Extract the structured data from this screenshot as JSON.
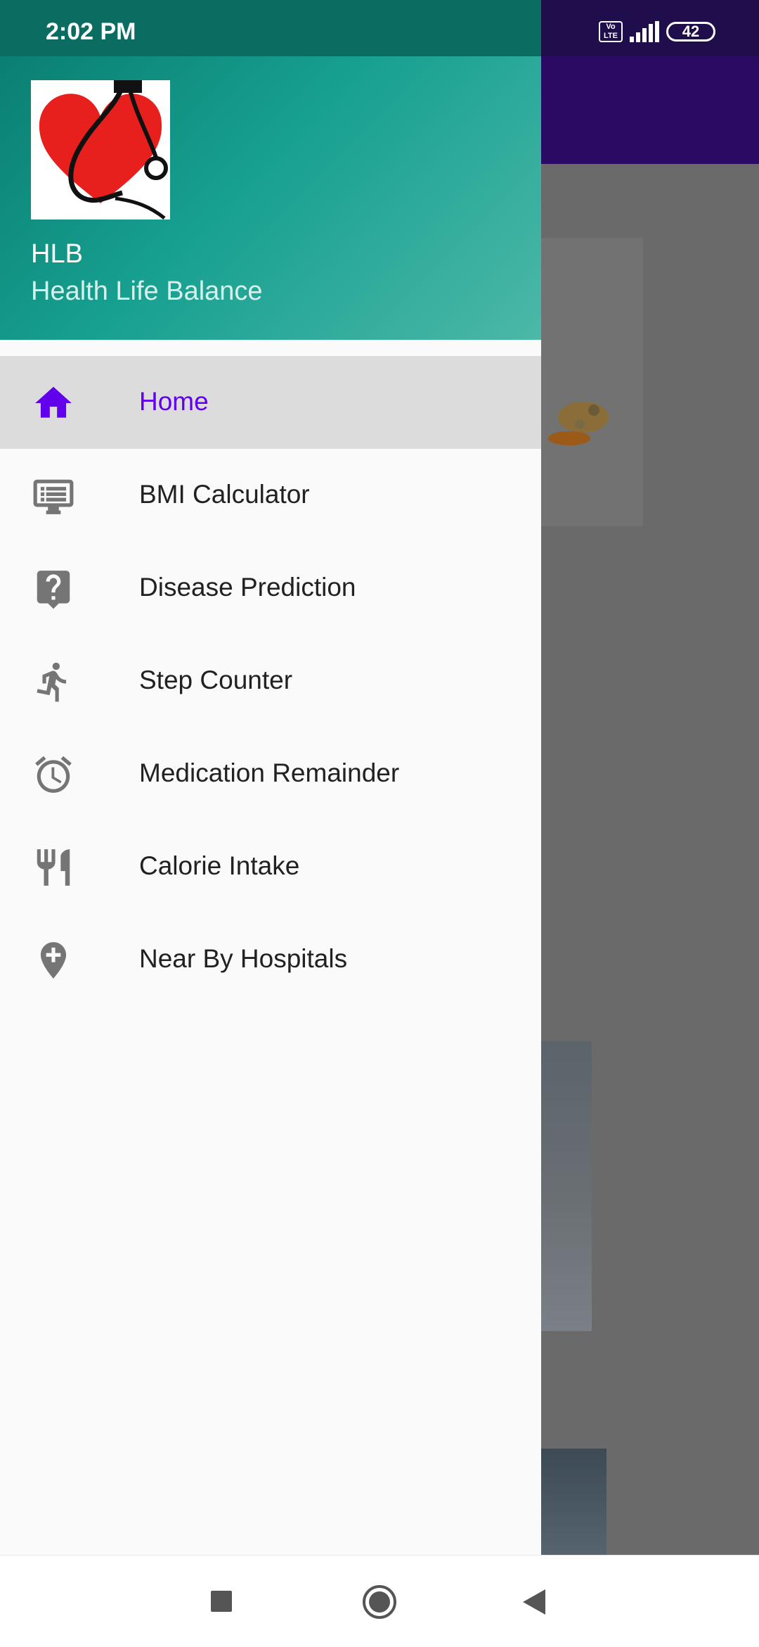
{
  "status_bar": {
    "time": "2:02 PM",
    "volte_label": "Vo LTE",
    "battery": "42"
  },
  "drawer": {
    "app_name": "HLB",
    "app_subtitle": "Health Life Balance",
    "items": [
      {
        "label": "Home",
        "icon": "home-icon",
        "active": true
      },
      {
        "label": "BMI Calculator",
        "icon": "list-screen-icon",
        "active": false
      },
      {
        "label": "Disease Prediction",
        "icon": "question-icon",
        "active": false
      },
      {
        "label": "Step Counter",
        "icon": "running-icon",
        "active": false
      },
      {
        "label": "Medication Remainder",
        "icon": "alarm-icon",
        "active": false
      },
      {
        "label": "Calorie Intake",
        "icon": "restaurant-icon",
        "active": false
      },
      {
        "label": "Near By Hospitals",
        "icon": "location-plus-icon",
        "active": false
      }
    ]
  },
  "colors": {
    "accent": "#6200ee",
    "header_start": "#0a7f71",
    "header_end": "#4cb8a8",
    "toolbar": "#2a0a63",
    "icon_gray": "#757575"
  }
}
